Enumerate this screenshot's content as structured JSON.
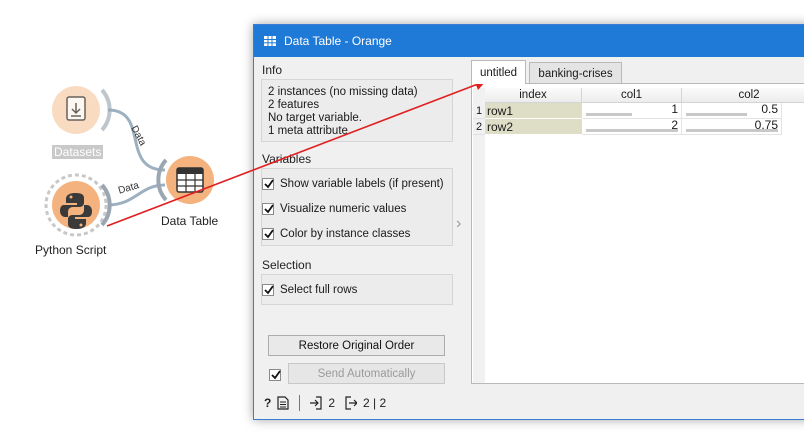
{
  "canvas": {
    "nodes": [
      {
        "label": "Datasets",
        "icon": "file-import-icon"
      },
      {
        "label": "Python Script",
        "icon": "python-icon"
      },
      {
        "label": "Data Table",
        "icon": "table-icon"
      }
    ],
    "links": [
      {
        "label": "Data"
      },
      {
        "label": "Data"
      }
    ]
  },
  "window": {
    "title": "Data Table - Orange",
    "info": {
      "section_title": "Info",
      "lines": [
        "2 instances (no missing data)",
        "2 features",
        "No target variable.",
        "1 meta attribute"
      ]
    },
    "variables": {
      "section_title": "Variables",
      "options": [
        {
          "label": "Show variable labels (if present)",
          "checked": true
        },
        {
          "label": "Visualize numeric values",
          "checked": true
        },
        {
          "label": "Color by instance classes",
          "checked": true
        }
      ]
    },
    "selection": {
      "section_title": "Selection",
      "options": [
        {
          "label": "Select full rows",
          "checked": true
        }
      ]
    },
    "restore_button": "Restore Original Order",
    "send_button": "Send Automatically",
    "send_auto_checked": true,
    "status": {
      "input_count": "2",
      "output_count": "2 | 2"
    },
    "tabs": [
      {
        "label": "untitled",
        "active": true
      },
      {
        "label": "banking-crises",
        "active": false
      }
    ],
    "table": {
      "columns": [
        "index",
        "col1",
        "col2"
      ],
      "rows": [
        {
          "num": "1",
          "index": "row1",
          "col1": "1",
          "col2": "0.5",
          "col1_frac": 0.5,
          "col2_frac": 0.667
        },
        {
          "num": "2",
          "index": "row2",
          "col1": "2",
          "col2": "0.75",
          "col1_frac": 1.0,
          "col2_frac": 1.0
        }
      ]
    },
    "colors": {
      "titlebar": "#1f79d6",
      "meta_cell": "#deddc5",
      "node_ring": "#f3b27e",
      "arrow": "#e02020"
    }
  }
}
